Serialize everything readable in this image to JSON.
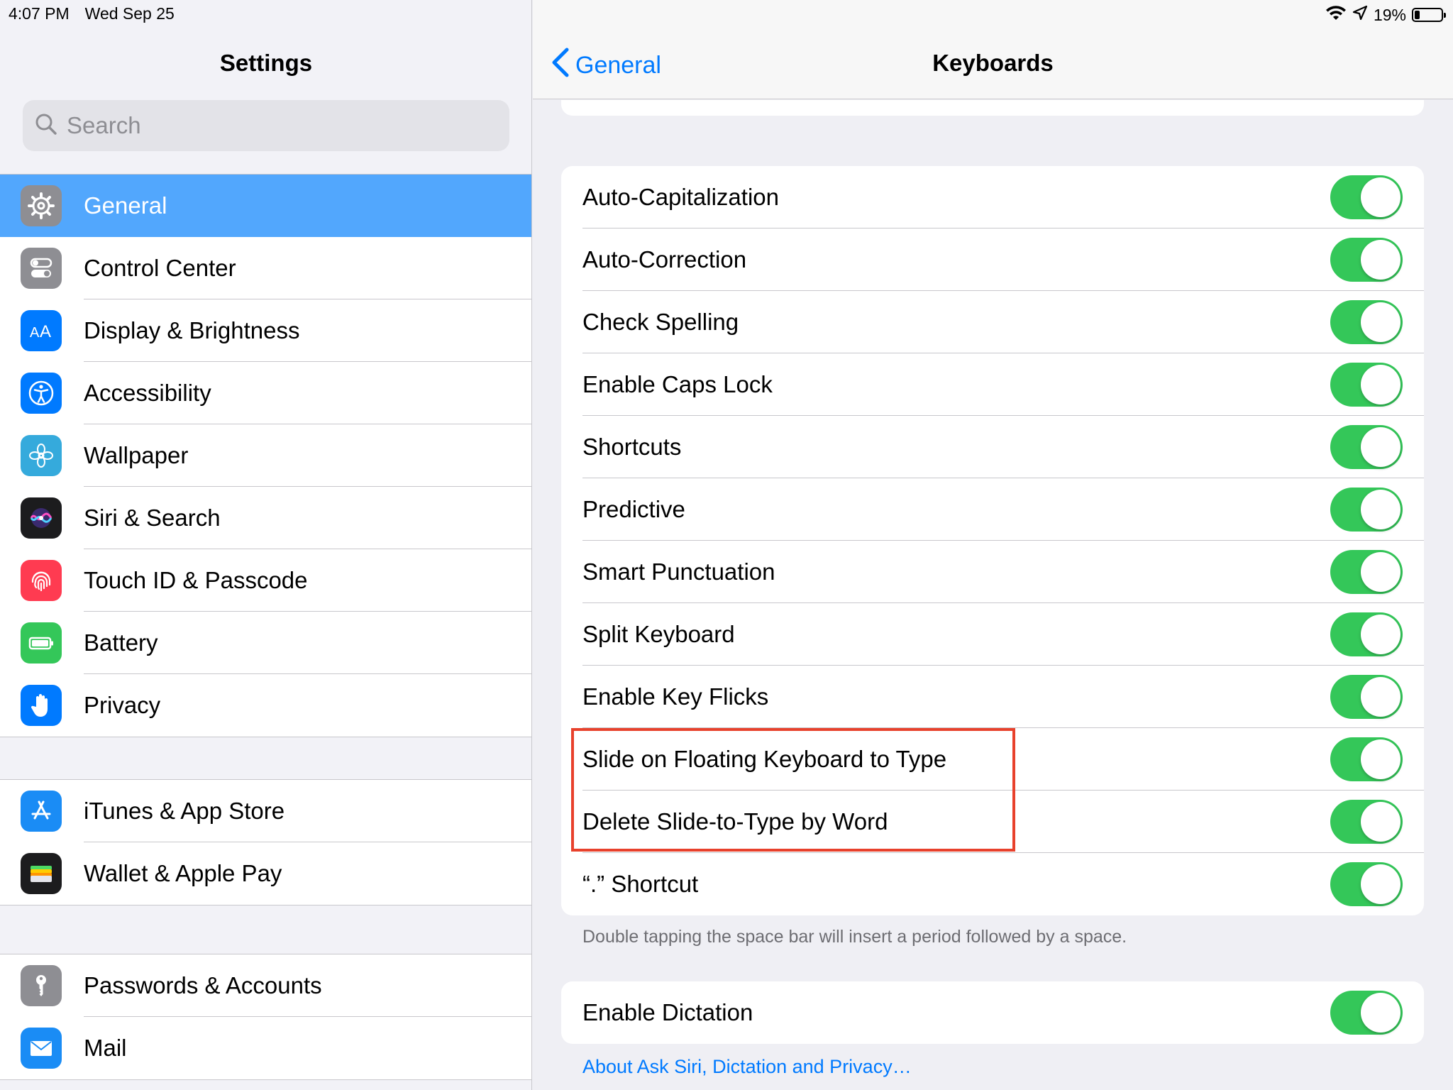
{
  "status_bar": {
    "time": "4:07 PM",
    "date": "Wed Sep 25",
    "battery_percent": "19%",
    "battery_level": 0.19
  },
  "sidebar": {
    "title": "Settings",
    "search": {
      "placeholder": "Search"
    },
    "groups": [
      [
        {
          "label": "General",
          "icon": "gear-icon",
          "color": "#8e8e93",
          "selected": true
        },
        {
          "label": "Control Center",
          "icon": "toggles-icon",
          "color": "#8e8e93"
        },
        {
          "label": "Display & Brightness",
          "icon": "text-size-icon",
          "color": "#007aff"
        },
        {
          "label": "Accessibility",
          "icon": "accessibility-icon",
          "color": "#007aff"
        },
        {
          "label": "Wallpaper",
          "icon": "flower-icon",
          "color": "#35aadc"
        },
        {
          "label": "Siri & Search",
          "icon": "siri-icon",
          "color": "#1c1c1e"
        },
        {
          "label": "Touch ID & Passcode",
          "icon": "fingerprint-icon",
          "color": "#ff3b51"
        },
        {
          "label": "Battery",
          "icon": "battery-icon",
          "color": "#34c759"
        },
        {
          "label": "Privacy",
          "icon": "hand-icon",
          "color": "#007aff"
        }
      ],
      [
        {
          "label": "iTunes & App Store",
          "icon": "app-store-icon",
          "color": "#1a8cf5"
        },
        {
          "label": "Wallet & Apple Pay",
          "icon": "wallet-icon",
          "color": "#1c1c1e"
        }
      ],
      [
        {
          "label": "Passwords & Accounts",
          "icon": "key-icon",
          "color": "#8e8e93"
        },
        {
          "label": "Mail",
          "icon": "mail-icon",
          "color": "#1a8cf5"
        }
      ]
    ]
  },
  "detail": {
    "back_label": "General",
    "title": "Keyboards",
    "toggles": [
      {
        "label": "Auto-Capitalization",
        "on": true
      },
      {
        "label": "Auto-Correction",
        "on": true
      },
      {
        "label": "Check Spelling",
        "on": true
      },
      {
        "label": "Enable Caps Lock",
        "on": true
      },
      {
        "label": "Shortcuts",
        "on": true
      },
      {
        "label": "Predictive",
        "on": true
      },
      {
        "label": "Smart Punctuation",
        "on": true
      },
      {
        "label": "Split Keyboard",
        "on": true
      },
      {
        "label": "Enable Key Flicks",
        "on": true
      },
      {
        "label": "Slide on Floating Keyboard to Type",
        "on": true
      },
      {
        "label": "Delete Slide-to-Type by Word",
        "on": true
      },
      {
        "label": "“.” Shortcut",
        "on": true
      }
    ],
    "footnote": "Double tapping the space bar will insert a period followed by a space.",
    "dictation": {
      "label": "Enable Dictation",
      "on": true
    },
    "privacy_link": "About Ask Siri, Dictation and Privacy…"
  },
  "colors": {
    "accent": "#007aff",
    "toggle_on": "#34c759",
    "selection": "#52a7fd",
    "highlight": "#e8412c"
  }
}
